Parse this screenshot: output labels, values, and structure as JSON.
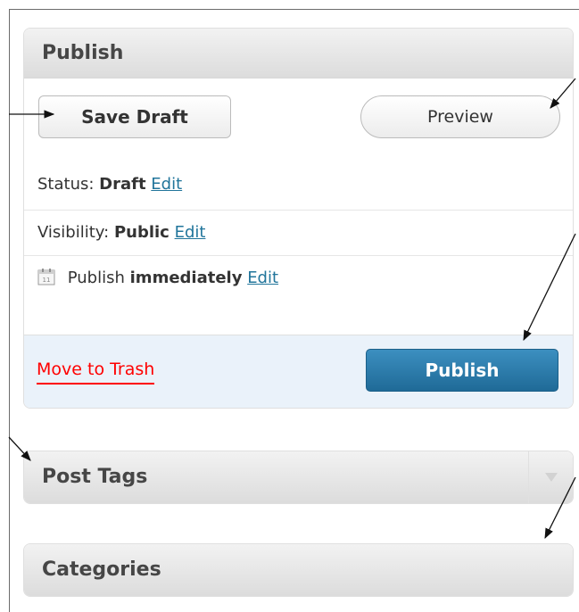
{
  "publish_box": {
    "title": "Publish",
    "save_draft_label": "Save Draft",
    "preview_label": "Preview",
    "status": {
      "label": "Status:",
      "value": "Draft",
      "edit": "Edit"
    },
    "visibility": {
      "label": "Visibility:",
      "value": "Public",
      "edit": "Edit"
    },
    "schedule": {
      "label": "Publish",
      "value": "immediately",
      "edit": "Edit",
      "icon": "calendar-icon"
    },
    "trash_label": "Move to Trash",
    "publish_label": "Publish"
  },
  "post_tags_box": {
    "title": "Post Tags",
    "toggle_icon": "triangle-down-icon"
  },
  "categories_box": {
    "title": "Categories"
  },
  "colors": {
    "link": "#21759b",
    "trash": "#ff0000",
    "publish_button": "#2a7ab0",
    "footer_bg": "#eaf2fa"
  }
}
